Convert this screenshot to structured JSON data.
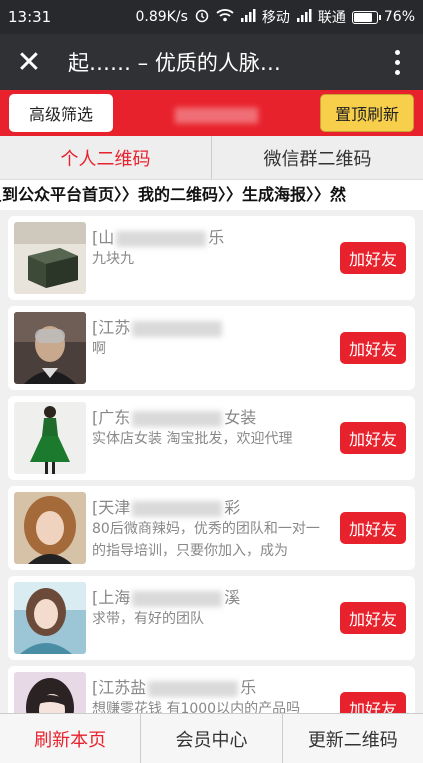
{
  "status_bar": {
    "time": "13:31",
    "speed": "0.89K/s",
    "carrier1": "移动",
    "carrier2": "联通",
    "battery": "76%",
    "battery_level": 0.76
  },
  "title_bar": {
    "title": "起…… – 优质的人脉…",
    "close_icon": "close-icon",
    "more_icon": "more-vertical-icon"
  },
  "toolbar": {
    "filter_label": "高级筛选",
    "refresh_label": "置顶刷新"
  },
  "tabs": [
    {
      "label": "个人二维码",
      "active": true
    },
    {
      "label": "微信群二维码",
      "active": false
    }
  ],
  "breadcrumb": "员到公众平台首页〉〉我的二维码〉〉生成海报〉〉然",
  "list": [
    {
      "name_prefix": "[山",
      "name_suffix": "乐",
      "desc": "九块九",
      "avatar": "product-box"
    },
    {
      "name_prefix": "[江苏",
      "name_suffix": "",
      "desc": "啊",
      "avatar": "man-portrait"
    },
    {
      "name_prefix": "[广东",
      "name_suffix": "女装",
      "desc": "实体店女装 淘宝批发，欢迎代理",
      "avatar": "green-dress"
    },
    {
      "name_prefix": "[天津",
      "name_suffix": "彩",
      "desc": "80后微商辣妈，优秀的团队和一对一的指导培训，只要你加入，成为",
      "avatar": "woman-portrait"
    },
    {
      "name_prefix": "[上海",
      "name_suffix": "溪",
      "desc": "求带，有好的团队",
      "avatar": "woman-blue"
    },
    {
      "name_prefix": "[江苏盐",
      "name_suffix": "乐",
      "desc": "想赚零花钱 有1000以内的产品吗",
      "avatar": "girl-portrait"
    }
  ],
  "add_label": "加好友",
  "bottom_bar": [
    {
      "label": "刷新本页",
      "active": true
    },
    {
      "label": "会员中心",
      "active": false
    },
    {
      "label": "更新二维码",
      "active": false
    }
  ],
  "colors": {
    "accent": "#e8222c",
    "yellow": "#f7cf4a",
    "dark": "#2f3135"
  }
}
